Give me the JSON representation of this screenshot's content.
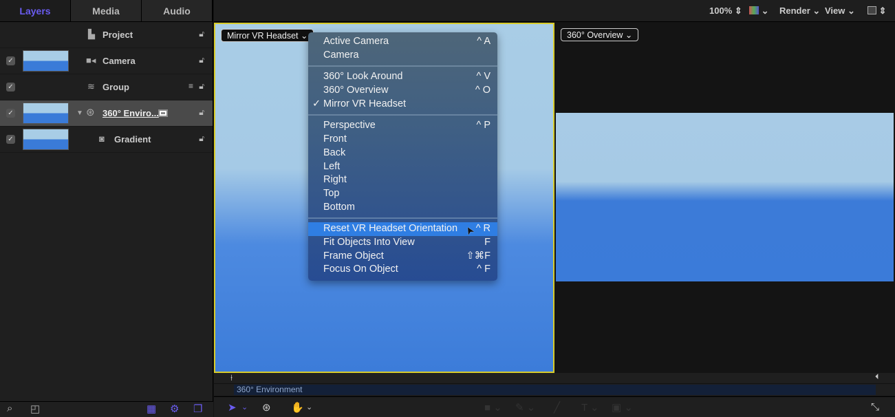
{
  "left_panel": {
    "tabs": [
      {
        "label": "Layers",
        "active": true
      },
      {
        "label": "Media"
      },
      {
        "label": "Audio"
      }
    ],
    "layers": [
      {
        "name": "Project",
        "icon": "document-icon"
      },
      {
        "name": "Camera",
        "icon": "camera-icon",
        "checked": true
      },
      {
        "name": "Group",
        "icon": "group-layers-icon",
        "checked": true
      },
      {
        "name": "360° Enviro...",
        "icon": "360-environment-icon",
        "checked": true,
        "selected": true
      },
      {
        "name": "Gradient",
        "icon": "gradient-generator-icon",
        "checked": true
      }
    ]
  },
  "toolbar": {
    "zoom": "100%",
    "render": "Render",
    "view": "View"
  },
  "viewer_left": {
    "camera_menu": "Mirror VR Headset"
  },
  "viewer_right": {
    "camera_menu": "360° Overview"
  },
  "menu": {
    "groups": [
      [
        {
          "label": "Active Camera",
          "shortcut": "^ A"
        },
        {
          "label": "Camera",
          "shortcut": ""
        }
      ],
      [
        {
          "label": "360° Look Around",
          "shortcut": "^ V"
        },
        {
          "label": "360° Overview",
          "shortcut": "^ O"
        },
        {
          "label": "Mirror VR Headset",
          "shortcut": "",
          "checked": true
        }
      ],
      [
        {
          "label": "Perspective",
          "shortcut": "^ P"
        },
        {
          "label": "Front",
          "shortcut": ""
        },
        {
          "label": "Back",
          "shortcut": ""
        },
        {
          "label": "Left",
          "shortcut": ""
        },
        {
          "label": "Right",
          "shortcut": ""
        },
        {
          "label": "Top",
          "shortcut": ""
        },
        {
          "label": "Bottom",
          "shortcut": ""
        }
      ],
      [
        {
          "label": "Reset VR Headset Orientation",
          "shortcut": "^ R",
          "highlighted": true
        },
        {
          "label": "Fit Objects Into View",
          "shortcut": "F"
        },
        {
          "label": "Frame Object",
          "shortcut": "⇧⌘F"
        },
        {
          "label": "Focus On Object",
          "shortcut": "^ F"
        }
      ]
    ],
    "checkmark": "✓"
  },
  "timeline": {
    "clip": "360° Environment"
  },
  "colors": {
    "accent": "#6a5cf0",
    "selection_border": "#d8cc2a",
    "menu_highlight": "#2f7ee3",
    "sky": "#a9cde6",
    "ground": "#3c7cd9"
  }
}
